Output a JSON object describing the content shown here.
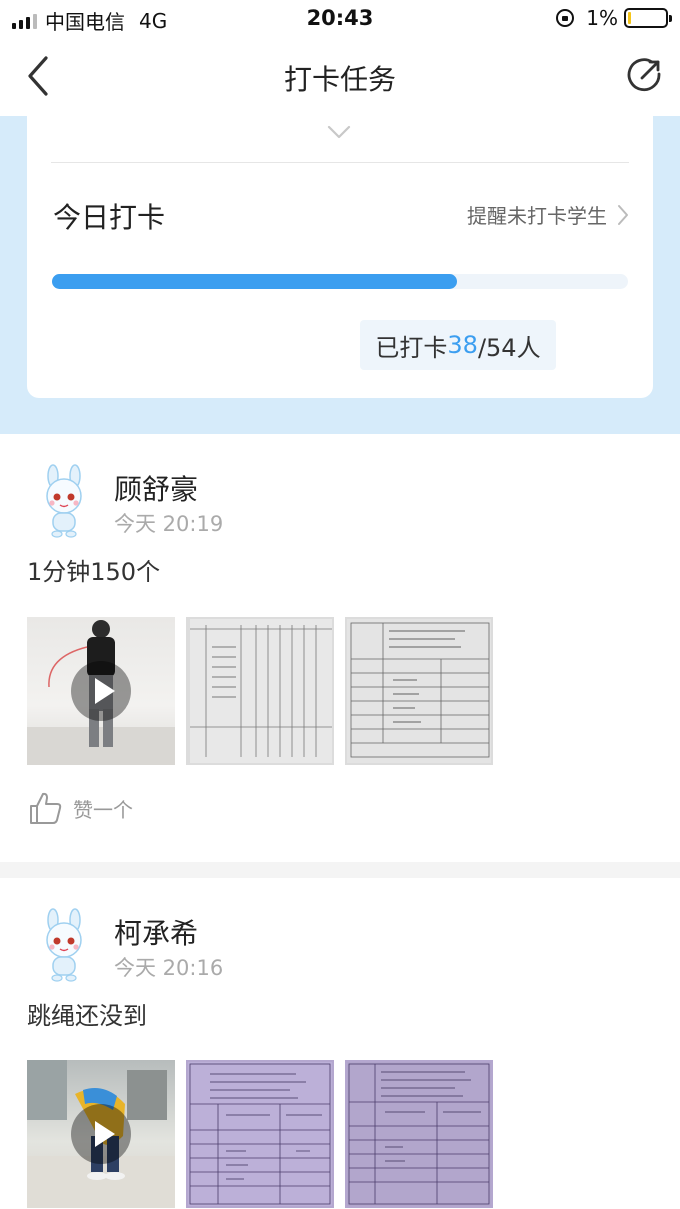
{
  "status_bar": {
    "carrier": "中国电信",
    "network": "4G",
    "time": "20:43",
    "battery": "1%"
  },
  "nav": {
    "title": "打卡任务"
  },
  "summary": {
    "title": "今日打卡",
    "remind_label": "提醒未打卡学生",
    "progress": {
      "done": 38,
      "total": 54,
      "fraction": 0.7037
    },
    "count_prefix": "已打卡",
    "count_done": "38",
    "count_suffix": "/54人"
  },
  "posts": [
    {
      "name": "顾舒豪",
      "time": "今天 20:19",
      "text": "1分钟150个",
      "media": [
        "video",
        "image",
        "image"
      ],
      "like_label": "赞一个"
    },
    {
      "name": "柯承希",
      "time": "今天 20:16",
      "text": "跳绳还没到",
      "media": [
        "video",
        "image",
        "image"
      ]
    }
  ],
  "colors": {
    "accent": "#3b9ef0",
    "header_bg": "#d6ebfa",
    "paper_purple": "#b4a7cf"
  }
}
